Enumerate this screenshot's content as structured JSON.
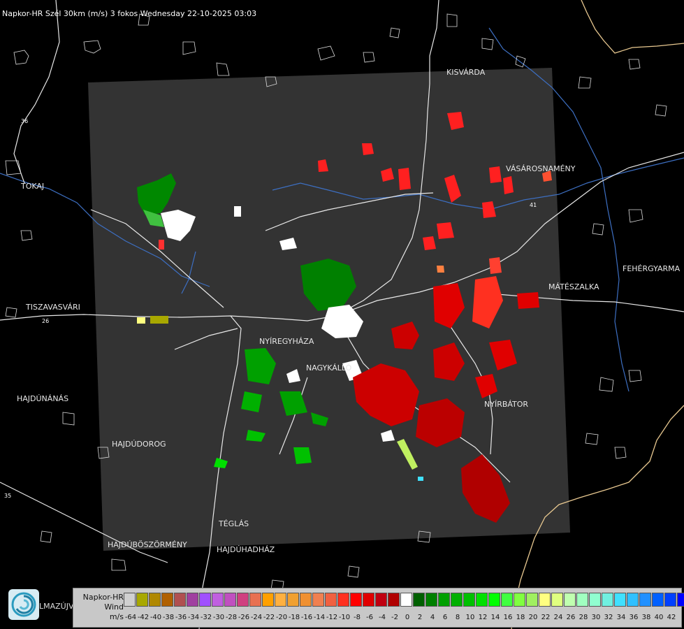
{
  "title": "Napkor-HR Szél 30km (m/s) 3 fokos Wednesday 22-10-2025 03:03",
  "cities": [
    {
      "id": "kisvarda",
      "name": "KISVÁRDA"
    },
    {
      "id": "vasarosnameny",
      "name": "VÁSÁROSNAMÉNY"
    },
    {
      "id": "tokaj",
      "name": "TOKAJ"
    },
    {
      "id": "fehergyarmat",
      "name": "FEHÉRGYARMA"
    },
    {
      "id": "mateszalka",
      "name": "MÁTÉSZALKA"
    },
    {
      "id": "tiszavasvari",
      "name": "TISZAVASVÁRI"
    },
    {
      "id": "nyiregyhaza",
      "name": "NYÍREGYHÁZA"
    },
    {
      "id": "nagykallo",
      "name": "NAGYKÁLLÓ"
    },
    {
      "id": "hajdunanas",
      "name": "HAJDÚNÁNÁS"
    },
    {
      "id": "nyirbator",
      "name": "NYÍRBÁTOR"
    },
    {
      "id": "hajdudorog",
      "name": "HAJDÚDOROG"
    },
    {
      "id": "teglas",
      "name": "TÉGLÁS"
    },
    {
      "id": "hajduboszormeny",
      "name": "HAJDÚBÖSZÖRMÉNY"
    },
    {
      "id": "hajduhadhaz",
      "name": "HAJDÚHADHÁZ"
    }
  ],
  "road_numbers": [
    "36",
    "41",
    "26",
    "35"
  ],
  "partial_label": "LMAZÚJVÁR",
  "logo_icon": "napkor-logo-icon",
  "legend": {
    "product": "Napkor-HR",
    "quantity": "Wind",
    "unit": "m/s",
    "colors": [
      "#d0d0d0",
      "#a8a800",
      "#b08800",
      "#b06000",
      "#b05050",
      "#a040a0",
      "#a050ff",
      "#c060e0",
      "#c050c0",
      "#d04080",
      "#e87050",
      "#ffa000",
      "#ffb040",
      "#f0a030",
      "#f09030",
      "#f08050",
      "#f06040",
      "#ff3020",
      "#ff0000",
      "#e00000",
      "#c00010",
      "#b00000",
      "#ffffff",
      "#006000",
      "#008000",
      "#00a000",
      "#00b000",
      "#00c000",
      "#00e000",
      "#00ff00",
      "#40ff40",
      "#80ff40",
      "#a0f060",
      "#ffff80",
      "#e0ff80",
      "#c0ffb0",
      "#a0ffc0",
      "#90ffd0",
      "#70f0e0",
      "#40e0ff",
      "#30c0ff",
      "#2090ff",
      "#0060ff",
      "#0040ff",
      "#0000ff"
    ],
    "ticks": [
      "-64",
      "-42",
      "-40",
      "-38",
      "-36",
      "-34",
      "-32",
      "-30",
      "-28",
      "-26",
      "-24",
      "-22",
      "-20",
      "-18",
      "-16",
      "-14",
      "-12",
      "-10",
      "-8",
      "-6",
      "-4",
      "-2",
      "0",
      "2",
      "4",
      "6",
      "8",
      "10",
      "12",
      "14",
      "16",
      "18",
      "20",
      "22",
      "24",
      "26",
      "28",
      "30",
      "32",
      "34",
      "36",
      "38",
      "40",
      "42"
    ]
  }
}
